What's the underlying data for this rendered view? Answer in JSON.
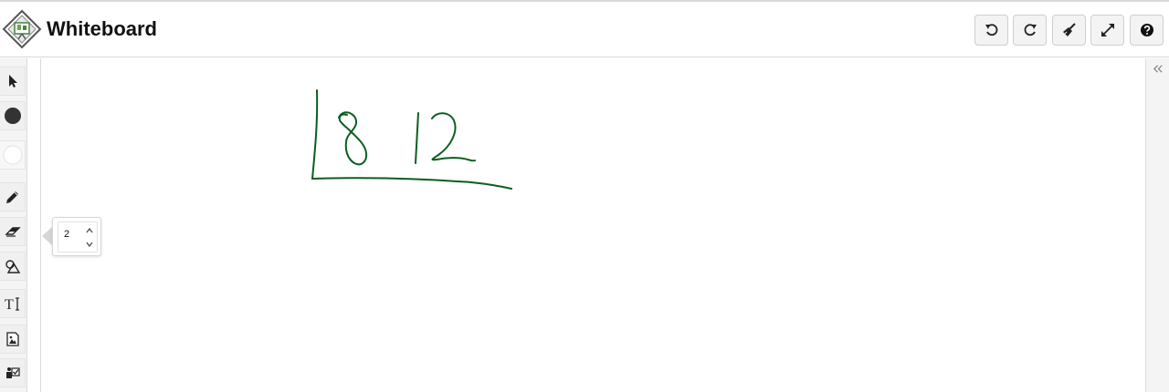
{
  "header": {
    "logo_icon": "whiteboard-logo-icon",
    "title": "Whiteboard",
    "buttons": [
      {
        "name": "undo",
        "icon": "undo-icon"
      },
      {
        "name": "redo",
        "icon": "redo-icon"
      },
      {
        "name": "clear",
        "icon": "broom-icon"
      },
      {
        "name": "fullscreen",
        "icon": "expand-icon"
      },
      {
        "name": "help",
        "icon": "help-icon"
      }
    ]
  },
  "toolbar": {
    "tools": [
      {
        "name": "select",
        "icon": "cursor-arrow-icon"
      },
      {
        "name": "stroke-color",
        "icon": "color-swatch-dark-icon",
        "color": "#333333"
      },
      {
        "name": "fill-color",
        "icon": "color-swatch-white-icon",
        "color": "#ffffff"
      },
      {
        "name": "pencil",
        "icon": "pencil-icon"
      },
      {
        "name": "eraser",
        "icon": "eraser-icon"
      },
      {
        "name": "shapes",
        "icon": "shapes-icon"
      },
      {
        "name": "text",
        "icon": "text-icon"
      },
      {
        "name": "image",
        "icon": "image-icon"
      },
      {
        "name": "checkbox",
        "icon": "checkbox-icon"
      }
    ]
  },
  "size_popover": {
    "value": "2"
  },
  "right_panel": {
    "collapse_icon": "double-chevron-left-icon"
  },
  "canvas": {
    "ink_color": "#0b5e1f"
  }
}
